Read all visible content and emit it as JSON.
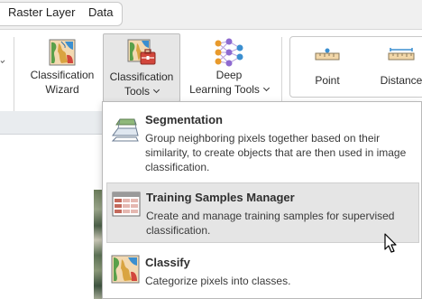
{
  "tabs": [
    {
      "label": "Raster Layer"
    },
    {
      "label": "Data"
    }
  ],
  "ribbon": {
    "classification_wizard": {
      "line1": "Classification",
      "line2": "Wizard"
    },
    "classification_tools": {
      "line1": "Classification",
      "line2": "Tools"
    },
    "deep_learning_tools": {
      "line1": "Deep",
      "line2": "Learning Tools"
    },
    "measure": {
      "point": "Point",
      "distance": "Distance"
    }
  },
  "menu": {
    "items": [
      {
        "title": "Segmentation",
        "description": "Group neighboring pixels together based on their similarity, to create objects that are then used in image classification.",
        "icon": "segmentation-icon"
      },
      {
        "title": "Training Samples Manager",
        "description": "Create and manage training samples for supervised classification.",
        "icon": "training-samples-icon"
      },
      {
        "title": "Classify",
        "description": "Categorize pixels into classes.",
        "icon": "classify-icon"
      }
    ]
  },
  "colors": {
    "accent_blue": "#3b6fb6",
    "highlight_bg": "#e5e5e5",
    "map_green": "#5aa04a",
    "map_red": "#d2463c"
  }
}
